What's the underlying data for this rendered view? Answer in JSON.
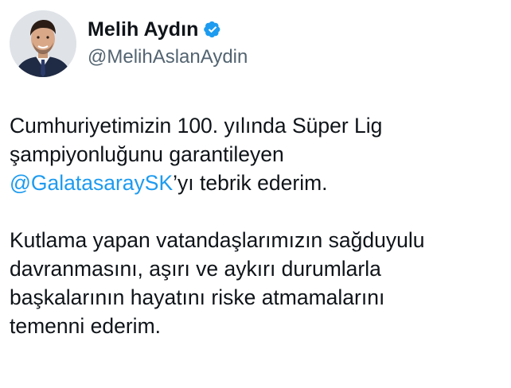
{
  "author": {
    "display_name": "Melih Aydın",
    "handle": "@MelihAslanAydin",
    "verified": true,
    "verified_icon": "verified-badge-icon",
    "avatar_icon": "profile-photo"
  },
  "tweet": {
    "paragraph1": {
      "line1": "Cumhuriyetimizin 100. yılında Süper Lig",
      "line2": "şampiyonluğunu garantileyen",
      "line3_mention": "@GalatasaraySK",
      "line3_rest": "’yı tebrik ederim."
    },
    "paragraph2": {
      "line1": "Kutlama yapan vatandaşlarımızın sağduyulu",
      "line2": "davranmasını, aşırı ve aykırı durumlarla",
      "line3": "başkalarının hayatını riske atmamalarını",
      "line4": "temenni ederim."
    }
  },
  "colors": {
    "text": "#0f1419",
    "secondary_text": "#536471",
    "link": "#1d9bf0",
    "verified_badge": "#1d9bf0",
    "background": "#ffffff"
  }
}
